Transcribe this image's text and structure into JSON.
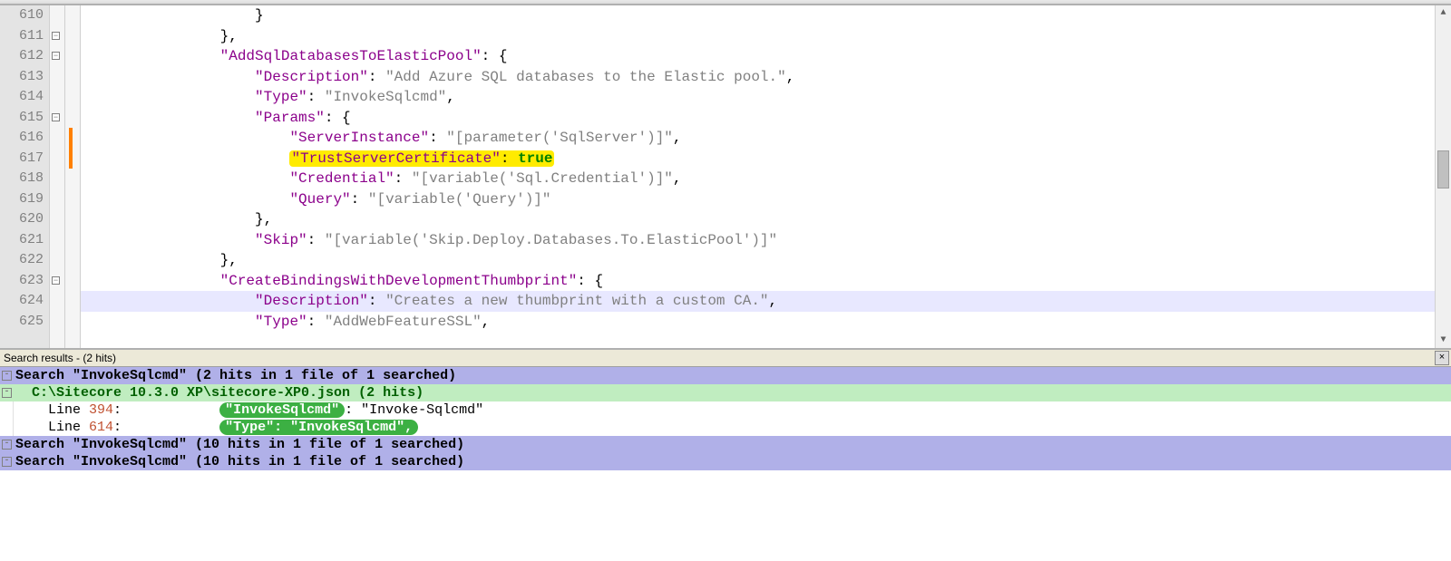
{
  "editor": {
    "first_line_no": 610,
    "current_line_index": 14,
    "fold_boxes_at": [
      1,
      2,
      5,
      13
    ],
    "change_marks_at": [
      6,
      7
    ],
    "lines": [
      {
        "indent": 20,
        "tokens": [
          {
            "cls": "punc",
            "t": "}"
          }
        ]
      },
      {
        "indent": 16,
        "tokens": [
          {
            "cls": "punc",
            "t": "},"
          }
        ]
      },
      {
        "indent": 16,
        "tokens": [
          {
            "cls": "key",
            "t": "\"AddSqlDatabasesToElasticPool\""
          },
          {
            "cls": "punc",
            "t": ": {"
          }
        ]
      },
      {
        "indent": 20,
        "tokens": [
          {
            "cls": "key",
            "t": "\"Description\""
          },
          {
            "cls": "punc",
            "t": ": "
          },
          {
            "cls": "str",
            "t": "\"Add Azure SQL databases to the Elastic pool.\""
          },
          {
            "cls": "punc",
            "t": ","
          }
        ]
      },
      {
        "indent": 20,
        "tokens": [
          {
            "cls": "key",
            "t": "\"Type\""
          },
          {
            "cls": "punc",
            "t": ": "
          },
          {
            "cls": "str",
            "t": "\"InvokeSqlcmd\""
          },
          {
            "cls": "punc",
            "t": ","
          }
        ]
      },
      {
        "indent": 20,
        "tokens": [
          {
            "cls": "key",
            "t": "\"Params\""
          },
          {
            "cls": "punc",
            "t": ": {"
          }
        ]
      },
      {
        "indent": 24,
        "tokens": [
          {
            "cls": "key",
            "t": "\"ServerInstance\""
          },
          {
            "cls": "punc",
            "t": ": "
          },
          {
            "cls": "str",
            "t": "\"[parameter('SqlServer')]\""
          },
          {
            "cls": "punc",
            "t": ","
          }
        ]
      },
      {
        "indent": 24,
        "highlight": "yellow",
        "tokens": [
          {
            "cls": "key",
            "t": "\"TrustServerCertificate\""
          },
          {
            "cls": "punc",
            "t": ": "
          },
          {
            "cls": "bool",
            "t": "true"
          }
        ]
      },
      {
        "indent": 24,
        "tokens": [
          {
            "cls": "key",
            "t": "\"Credential\""
          },
          {
            "cls": "punc",
            "t": ": "
          },
          {
            "cls": "str",
            "t": "\"[variable('Sql.Credential')]\""
          },
          {
            "cls": "punc",
            "t": ","
          }
        ]
      },
      {
        "indent": 24,
        "tokens": [
          {
            "cls": "key",
            "t": "\"Query\""
          },
          {
            "cls": "punc",
            "t": ": "
          },
          {
            "cls": "str",
            "t": "\"[variable('Query')]\""
          }
        ]
      },
      {
        "indent": 20,
        "tokens": [
          {
            "cls": "punc",
            "t": "},"
          }
        ]
      },
      {
        "indent": 20,
        "tokens": [
          {
            "cls": "key",
            "t": "\"Skip\""
          },
          {
            "cls": "punc",
            "t": ": "
          },
          {
            "cls": "str",
            "t": "\"[variable('Skip.Deploy.Databases.To.ElasticPool')]\""
          }
        ]
      },
      {
        "indent": 16,
        "tokens": [
          {
            "cls": "punc",
            "t": "},"
          }
        ]
      },
      {
        "indent": 16,
        "tokens": [
          {
            "cls": "key",
            "t": "\"CreateBindingsWithDevelopmentThumbprint\""
          },
          {
            "cls": "punc",
            "t": ": {"
          }
        ]
      },
      {
        "indent": 20,
        "tokens": [
          {
            "cls": "key",
            "t": "\"Description\""
          },
          {
            "cls": "punc",
            "t": ": "
          },
          {
            "cls": "str",
            "t": "\"Creates a new thumbprint with a custom CA.\""
          },
          {
            "cls": "punc",
            "t": ","
          }
        ]
      },
      {
        "indent": 20,
        "tokens": [
          {
            "cls": "key",
            "t": "\"Type\""
          },
          {
            "cls": "punc",
            "t": ": "
          },
          {
            "cls": "str",
            "t": "\"AddWebFeatureSSL\""
          },
          {
            "cls": "punc",
            "t": ","
          }
        ]
      }
    ]
  },
  "search": {
    "title": "Search results - (2 hits)",
    "rows": [
      {
        "type": "header",
        "text": "Search \"InvokeSqlcmd\" (2 hits in 1 file of 1 searched)"
      },
      {
        "type": "file",
        "text": "  C:\\Sitecore 10.3.0 XP\\sitecore-XP0.json (2 hits)"
      },
      {
        "type": "hit",
        "prefix": "    Line ",
        "lineno": "394",
        "mid": ":            ",
        "hl": "\"InvokeSqlcmd\"",
        "rest": ": \"Invoke-Sqlcmd\""
      },
      {
        "type": "hit",
        "prefix": "    Line ",
        "lineno": "614",
        "mid": ":            ",
        "hl": "\"Type\": \"InvokeSqlcmd\",",
        "rest": ""
      },
      {
        "type": "header",
        "text": "Search \"InvokeSqlcmd\" (10 hits in 1 file of 1 searched)"
      },
      {
        "type": "header",
        "text": "Search \"InvokeSqlcmd\" (10 hits in 1 file of 1 searched)"
      }
    ]
  }
}
